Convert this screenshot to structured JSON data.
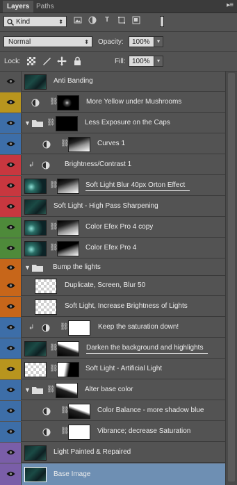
{
  "tabs": [
    {
      "label": "Layers",
      "active": true
    },
    {
      "label": "Paths",
      "active": false
    }
  ],
  "panel_menu_icon": "panel-menu-icon",
  "filter": {
    "kind_label": "Kind",
    "icons": [
      "pixel-filter-icon",
      "adjustment-filter-icon",
      "type-filter-icon",
      "shape-filter-icon",
      "smart-object-filter-icon"
    ],
    "toggle_icon": "filter-toggle-icon"
  },
  "blend": {
    "mode": "Normal",
    "opacity_label": "Opacity:",
    "opacity_value": "100%"
  },
  "lock": {
    "label": "Lock:",
    "icons": [
      "lock-transparent-pixels-icon",
      "lock-image-pixels-icon",
      "lock-position-icon",
      "lock-all-icon"
    ],
    "fill_label": "Fill:",
    "fill_value": "100%"
  },
  "colors": {
    "gray": "#535353",
    "yellow": "#b8951e",
    "blue": "#3d6ea8",
    "red": "#c8373f",
    "green": "#4e8a3a",
    "orange": "#c7661a",
    "violet": "#7a5ea8",
    "selected": "#6e8fb3"
  },
  "layers": [
    {
      "name": "Anti Banding",
      "color": "gray",
      "type": "pixel"
    },
    {
      "name": "More Yellow under Mushrooms",
      "color": "yellow",
      "type": "adjustment"
    },
    {
      "name": "Less Exposure on the Caps",
      "color": "blue",
      "type": "group"
    },
    {
      "name": "Curves 1",
      "color": "blue",
      "type": "adjustment"
    },
    {
      "name": "Brightness/Contrast 1",
      "color": "red",
      "type": "adjustment-clipped"
    },
    {
      "name": "Soft Light Blur 40px Orton Effect",
      "color": "red",
      "type": "pixel-mask"
    },
    {
      "name": "Soft Light - High Pass Sharpening",
      "color": "red",
      "type": "pixel"
    },
    {
      "name": "Color Efex Pro 4 copy",
      "color": "green",
      "type": "pixel-mask"
    },
    {
      "name": "Color Efex Pro 4",
      "color": "green",
      "type": "pixel-mask"
    },
    {
      "name": "Bump the lights",
      "color": "orange",
      "type": "group"
    },
    {
      "name": "Duplicate, Screen, Blur 50",
      "color": "orange",
      "type": "pixel"
    },
    {
      "name": "Soft Light, Increase Brightness of Lights",
      "color": "orange",
      "type": "pixel"
    },
    {
      "name": "Keep the saturation down!",
      "color": "blue",
      "type": "adjustment-clipped"
    },
    {
      "name": "Darken the background and highlights",
      "color": "blue",
      "type": "pixel-mask"
    },
    {
      "name": "Soft Light - Artificial Light",
      "color": "yellow",
      "type": "pixel-mask"
    },
    {
      "name": "Alter base color",
      "color": "blue",
      "type": "group"
    },
    {
      "name": "Color Balance - more shadow blue",
      "color": "blue",
      "type": "adjustment"
    },
    {
      "name": "Vibrance; decrease Saturation",
      "color": "blue",
      "type": "adjustment"
    },
    {
      "name": "Light Painted & Repaired",
      "color": "violet",
      "type": "pixel"
    },
    {
      "name": "Base Image",
      "color": "violet",
      "type": "pixel",
      "selected": true
    }
  ],
  "icons": {
    "eye": "eye-icon",
    "link": "mask-link-icon",
    "adjustment": "adjustment-layer-icon",
    "folder": "folder-icon",
    "disclosure": "disclosure-triangle-icon",
    "clip": "clipping-arrow-icon"
  }
}
